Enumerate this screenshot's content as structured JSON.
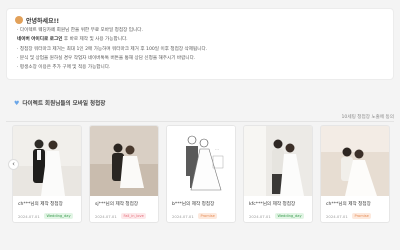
{
  "notice": {
    "title": "안녕하세요!!",
    "lines": [
      "· 다이렉트 웨딩카페 회원님 한을 위한 무료 모바일 청첩장 입니다.",
      "네이버 아이디로 로그인",
      "· 청첩장 워터마크 제거는 최대 1인 2매 가능하며 워터마크 제거 후 100일 이후 청첩장 삭제됩니다.",
      "· 분식 및 상업을 원하실 경우 작업자 네이버톡톡 버튼을 통해 상담 신청을 해주시기 바랍니다.",
      "· 평생소장 이용은 추가 구매 및 적용 가능합니다."
    ],
    "line2_suffix": " 후 바로 제작 및 사용 가능합니다."
  },
  "section": {
    "title": "다이렉트 회원님들의 모바일 청첩장",
    "limit_note": "10세팅 청첩장 노출에 동의"
  },
  "cards": [
    {
      "name": "ch***님의 제작 청첩장",
      "date": "2024.07.01",
      "tag": "Wedding_day",
      "tag_style": "green"
    },
    {
      "name": "sj***님의 제작 청첩장",
      "date": "2024.07.01",
      "tag": "Fall_in_love",
      "tag_style": "pink"
    },
    {
      "name": "b***님의 제작 청첩장",
      "date": "2024.07.01",
      "tag": "Promise",
      "tag_style": "orange"
    },
    {
      "name": "kfc***님의 제작 청첩장",
      "date": "2024.07.01",
      "tag": "Wedding_day",
      "tag_style": "green"
    },
    {
      "name": "ch***님의 제작 청첩장",
      "date": "2024.07.01",
      "tag": "Promise",
      "tag_style": "orange"
    }
  ],
  "controls": {
    "prev_label": "‹"
  }
}
